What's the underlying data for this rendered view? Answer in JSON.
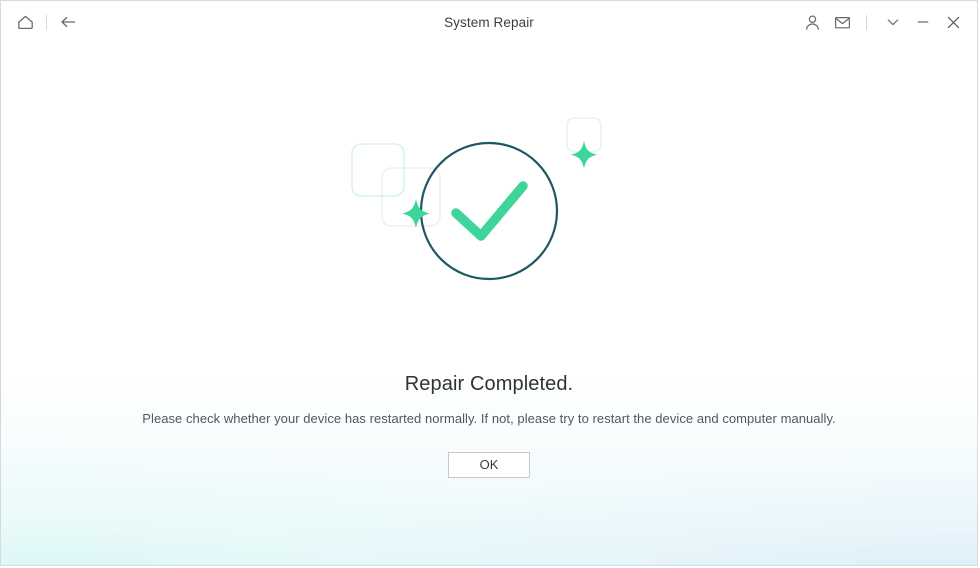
{
  "window": {
    "title": "System Repair",
    "border_color": "#d7d9db",
    "background": "#ffffff"
  },
  "titlebar": {
    "home_label": "Home",
    "back_label": "Back",
    "account_label": "Account",
    "mail_label": "Messages",
    "more_label": "More",
    "minimize_label": "Minimize",
    "close_label": "Close",
    "icons": {
      "home": "home-icon",
      "back": "arrow-left-icon",
      "account": "person-icon",
      "mail": "envelope-icon",
      "more": "chevron-down-icon",
      "minimize": "minimize-icon",
      "close": "close-icon"
    }
  },
  "illustration": {
    "name": "repair-success-illustration",
    "circle_color": "#1d5863",
    "check_color": "#3ed59b",
    "sparkle_color": "#3ed59b",
    "square_teal_color": "#d4f1ea",
    "square_gray_color": "#edf1f0",
    "square_mint_color": "#e2f6f2"
  },
  "main": {
    "headline": "Repair Completed.",
    "subline": "Please check whether your device has restarted normally. If not, please try to restart the device and computer manually.",
    "ok_label": "OK"
  },
  "theme": {
    "accent_green": "#3ed59b",
    "deep_teal": "#1d5863",
    "text_primary": "#2f3337",
    "text_secondary": "#53575b",
    "wash_left": "#e4f9f7",
    "wash_right": "#eaf4fb"
  }
}
